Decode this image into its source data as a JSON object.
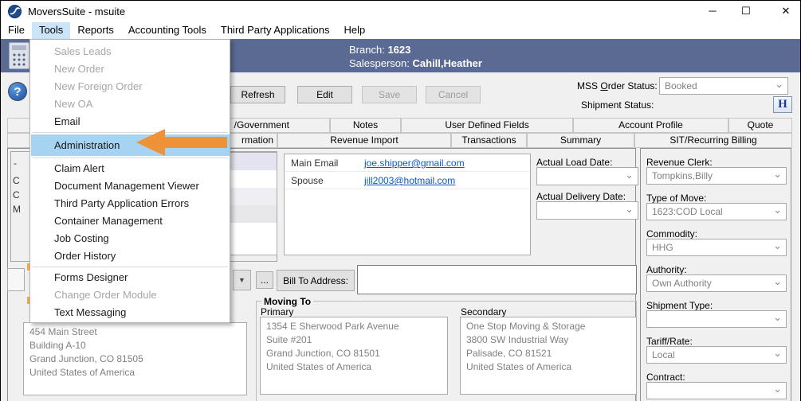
{
  "window": {
    "title": "MoversSuite - msuite",
    "controls": {
      "minimize": "─",
      "maximize": "☐",
      "close": "✕"
    }
  },
  "menubar": {
    "items": [
      {
        "label": "File",
        "active": false
      },
      {
        "label": "Tools",
        "active": true
      },
      {
        "label": "Reports",
        "active": false
      },
      {
        "label": "Accounting Tools",
        "active": false
      },
      {
        "label": "Third Party Applications",
        "active": false
      },
      {
        "label": "Help",
        "active": false
      }
    ]
  },
  "tools_menu": {
    "groups": [
      {
        "items": [
          {
            "label": "Sales Leads",
            "disabled": true
          },
          {
            "label": "New Order",
            "disabled": true
          },
          {
            "label": "New Foreign Order",
            "disabled": true
          },
          {
            "label": "New OA",
            "disabled": true
          },
          {
            "label": "Email",
            "disabled": false
          }
        ]
      },
      {
        "items": [
          {
            "label": "Administration",
            "disabled": false,
            "highlighted": true
          }
        ]
      },
      {
        "items": [
          {
            "label": "Claim Alert",
            "disabled": false
          },
          {
            "label": "Document Management Viewer",
            "disabled": false
          },
          {
            "label": "Third Party Application Errors",
            "disabled": false
          },
          {
            "label": "Container Management",
            "disabled": false
          },
          {
            "label": "Job Costing",
            "disabled": false
          },
          {
            "label": "Order History",
            "disabled": false
          }
        ]
      },
      {
        "items": [
          {
            "label": "Forms Designer",
            "disabled": false
          },
          {
            "label": "Change Order Module",
            "disabled": true
          },
          {
            "label": "Text Messaging",
            "disabled": false
          }
        ]
      }
    ]
  },
  "header": {
    "branch_label": "Branch:",
    "branch_value": "1623",
    "salesperson_label": "Salesperson:",
    "salesperson_value": "Cahill,Heather"
  },
  "toolbar": {
    "refresh_label": "Refresh",
    "edit_label": "Edit",
    "save_label": "Save",
    "cancel_label": "Cancel"
  },
  "order_status": {
    "mss_label_pre": "MSS ",
    "mss_label_accel": "O",
    "mss_label_post": "rder Status:",
    "mss_value": "Booked",
    "shipment_label": "Shipment Status:",
    "history_button": "H"
  },
  "tabs": {
    "row1": [
      "/Government",
      "Notes",
      "User Defined Fields",
      "Account Profile",
      "Quote"
    ],
    "row2": [
      "rmation",
      "Revenue Import",
      "Transactions",
      "Summary",
      "SIT/Recurring Billing"
    ]
  },
  "left_fragments": {
    "labels": [
      "C",
      "C",
      "M"
    ]
  },
  "contacts": {
    "rows": [
      {
        "label": "Main Email",
        "value": "joe.shipper@gmail.com"
      },
      {
        "label": "Spouse",
        "value": "jill2003@hotmail.com"
      }
    ]
  },
  "dates": {
    "load_label": "Actual Load Date:",
    "delivery_label": "Actual Delivery Date:"
  },
  "billing": {
    "dropdown_glyph": "▼",
    "ellipsis": "...",
    "bill_to_label": "Bill To Address:"
  },
  "moving_to": {
    "title": "Moving To",
    "primary_label": "Primary",
    "primary_address": "1354 E Sherwood Park Avenue\nSuite #201\nGrand Junction, CO 81501\nUnited States of America",
    "secondary_label": "Secondary",
    "secondary_address": "One Stop Moving & Storage\n3800 SW Industrial Way\nPalisade, CO 81521\nUnited States of America"
  },
  "origin_address": "454 Main Street\nBuilding A-10\nGrand Junction, CO 81505\nUnited States of America",
  "right_panel": {
    "fields": [
      {
        "label": "Revenue Clerk:",
        "value": "Tompkins,Billy"
      },
      {
        "label": "Type of Move:",
        "value": "1623:COD Local"
      },
      {
        "label": "Commodity:",
        "value": "HHG"
      },
      {
        "label": "Authority:",
        "value": "Own Authority"
      },
      {
        "label": "Shipment Type:",
        "value": ""
      },
      {
        "label": "Tariff/Rate:",
        "value": "Local"
      },
      {
        "label": "Contract:",
        "value": ""
      }
    ]
  },
  "colors": {
    "band": "#5a6a92",
    "menu_highlight": "#a7d3f2",
    "menubar_active": "#cce4f7",
    "arrow": "#ef9237",
    "link": "#0a58c8"
  }
}
